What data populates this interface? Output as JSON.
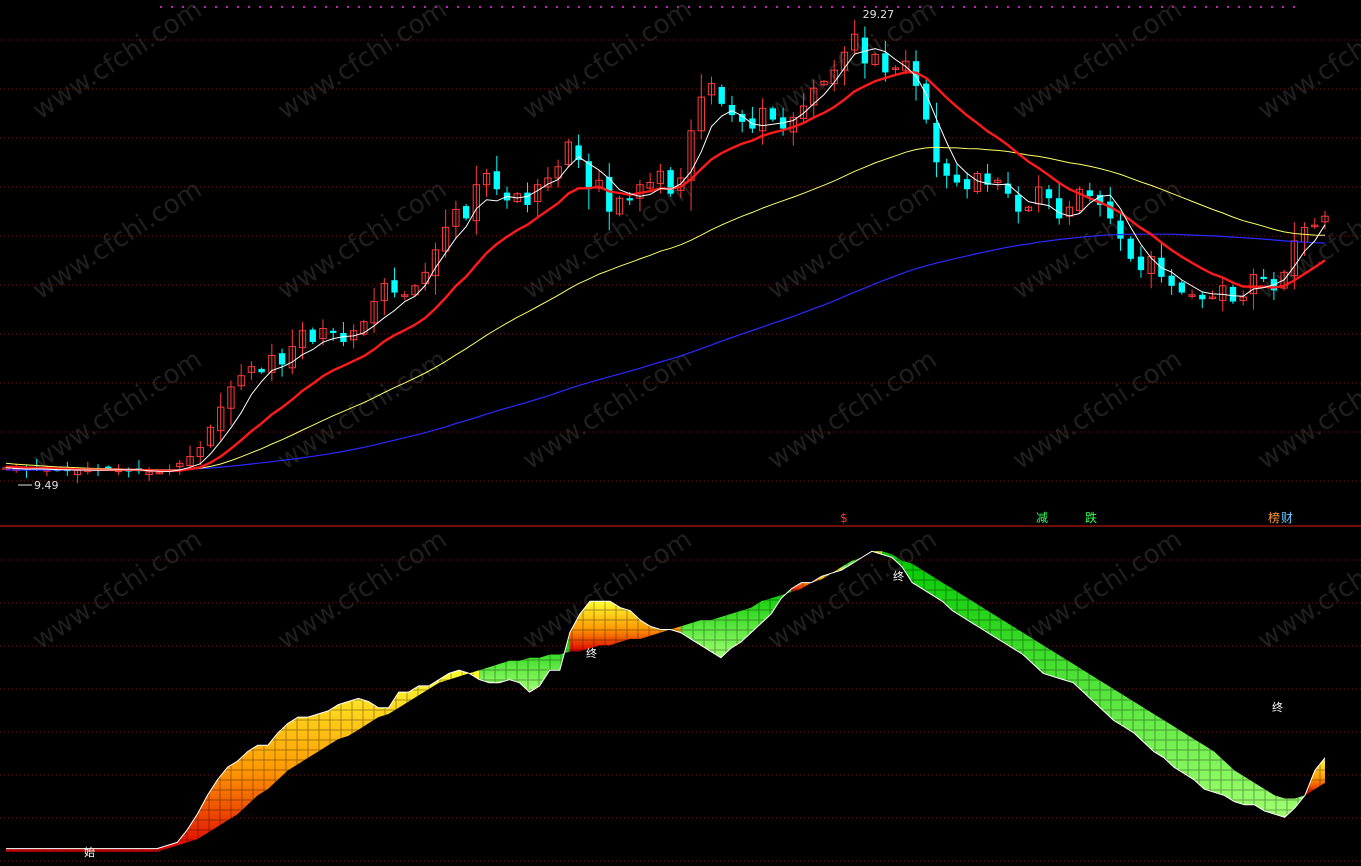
{
  "chart_data": [
    {
      "type": "candlestick",
      "title": "",
      "ylim": [
        8.8,
        29.9
      ],
      "grid": "dotted red horizontal",
      "annotations": {
        "high_label": "29.27",
        "low_label": "9.49"
      },
      "colors": {
        "up": "#ff3a3a",
        "down": "#00ffff",
        "ma_fast": "#ffffff",
        "ma_mid": "#ff1a1a",
        "ma_slow": "#ffff66",
        "ma_long": "#2a2aff"
      },
      "signals": [
        {
          "text": "$",
          "color": "#ff3030"
        },
        {
          "text": "减",
          "color": "#33ff55"
        },
        {
          "text": "跌",
          "color": "#33ff55"
        },
        {
          "text": "榜",
          "color": "#ff9933"
        },
        {
          "text": "财",
          "color": "#66ccff"
        }
      ],
      "closes": [
        9.7,
        9.65,
        9.6,
        9.68,
        9.62,
        9.58,
        9.55,
        9.58,
        9.62,
        9.6,
        9.66,
        9.6,
        9.58,
        9.55,
        9.52,
        9.5,
        9.6,
        9.9,
        10.2,
        10.6,
        11.5,
        12.4,
        13.3,
        13.8,
        14.2,
        13.95,
        14.7,
        14.3,
        15.1,
        15.8,
        15.3,
        15.9,
        15.7,
        15.3,
        15.8,
        16.2,
        17.1,
        17.9,
        17.5,
        17.4,
        17.8,
        18.4,
        19.4,
        20.4,
        21.2,
        20.8,
        22.3,
        22.8,
        22.1,
        21.6,
        21.9,
        21.4,
        22.3,
        22.6,
        23.1,
        24.2,
        23.4,
        22.1,
        22.5,
        21.1,
        21.7,
        21.6,
        22.3,
        22.4,
        22.9,
        21.9,
        22.6,
        24.7,
        26.2,
        26.8,
        25.9,
        25.4,
        25.1,
        24.8,
        25.7,
        25.2,
        24.8,
        25.3,
        25.8,
        26.6,
        26.9,
        27.4,
        28.2,
        29.0,
        27.7,
        28.1,
        27.3,
        27.5,
        27.8,
        26.7,
        25.2,
        23.3,
        22.7,
        22.4,
        22.1,
        22.8,
        22.3,
        22.5,
        21.9,
        21.1,
        21.3,
        22.2,
        21.7,
        20.8,
        21.3,
        22.1,
        21.8,
        21.4,
        20.8,
        19.9,
        19.0,
        18.5,
        19.1,
        18.2,
        17.8,
        17.5,
        17.4,
        17.2,
        17.3,
        17.8,
        17.1,
        17.3,
        18.3,
        18.1,
        17.6,
        18.4,
        19.8,
        20.4,
        20.5,
        20.9
      ],
      "ma_fast": [
        9.7,
        9.67,
        9.64,
        9.65,
        9.64,
        9.62,
        9.61,
        9.6,
        9.6,
        9.59,
        9.6,
        9.61,
        9.61,
        9.61,
        9.57,
        9.55,
        9.54,
        9.6,
        9.72,
        9.88,
        10.32,
        10.87,
        11.48,
        12.15,
        12.96,
        13.54,
        14.03,
        14.19,
        14.41,
        14.74,
        14.96,
        15.29,
        15.45,
        15.54,
        15.57,
        15.71,
        16.02,
        16.38,
        16.7,
        17.1,
        17.34,
        17.82,
        18.6,
        19.27,
        19.92,
        20.43,
        21.23,
        21.63,
        21.58,
        21.78,
        21.71,
        21.78,
        22.04,
        22.33,
        22.53,
        23.1,
        23.54,
        23.24,
        22.95,
        22.57,
        22.08,
        21.9,
        21.78,
        21.87,
        22.13,
        22.1,
        22.34,
        22.89,
        23.77,
        24.89,
        25.36,
        25.6,
        25.36,
        25.01,
        24.93,
        24.99,
        25.06,
        25.16,
        25.48,
        25.91,
        26.31,
        26.85,
        27.49,
        28.12,
        28.25,
        28.36,
        28.22,
        27.87,
        27.56,
        27.14,
        26.33,
        25.22,
        24.18,
        23.24,
        22.8,
        22.47,
        22.35,
        22.3,
        22.33,
        21.92,
        21.55,
        21.45,
        21.37,
        21.05,
        20.91,
        21.02,
        21.48,
        21.78,
        21.84,
        21.23,
        20.4,
        19.64,
        19.04,
        18.6,
        18.41,
        18.06,
        17.79,
        17.53,
        17.44,
        17.42,
        17.36,
        17.34,
        17.66,
        17.72,
        17.85,
        18.07,
        18.67,
        19.34,
        19.8,
        20.52
      ],
      "ma_mid": [
        9.75,
        9.73,
        9.71,
        9.7,
        9.68,
        9.66,
        9.65,
        9.63,
        9.62,
        9.61,
        9.61,
        9.61,
        9.61,
        9.61,
        9.59,
        9.57,
        9.57,
        9.58,
        9.64,
        9.72,
        9.93,
        10.2,
        10.55,
        10.93,
        11.33,
        11.68,
        12.07,
        12.39,
        12.74,
        13.13,
        13.44,
        13.78,
        14.04,
        14.24,
        14.46,
        14.67,
        14.97,
        15.33,
        15.6,
        15.83,
        16.07,
        16.37,
        16.79,
        17.27,
        17.8,
        18.21,
        18.74,
        19.26,
        19.66,
        19.98,
        20.28,
        20.52,
        20.85,
        21.16,
        21.48,
        21.91,
        22.14,
        22.14,
        22.22,
        22.0,
        21.93,
        21.85,
        21.93,
        22.01,
        22.14,
        22.12,
        22.21,
        22.55,
        23.0,
        23.43,
        23.71,
        23.93,
        24.13,
        24.27,
        24.48,
        24.62,
        24.73,
        24.87,
        25.05,
        25.29,
        25.5,
        25.76,
        26.09,
        26.46,
        26.69,
        26.91,
        27.05,
        27.19,
        27.31,
        27.29,
        27.05,
        26.62,
        26.17,
        25.77,
        25.38,
        25.04,
        24.68,
        24.39,
        24.06,
        23.68,
        23.33,
        23.04,
        22.72,
        22.38,
        22.1,
        21.9,
        21.7,
        21.51,
        21.31,
        21.05,
        20.71,
        20.37,
        20.09,
        19.73,
        19.39,
        19.09,
        18.82,
        18.56,
        18.33,
        18.17,
        17.94,
        17.77,
        17.76,
        17.76,
        17.72,
        17.8,
        18.04,
        18.34,
        18.63,
        18.94
      ],
      "ma_slow": [
        9.9,
        9.86,
        9.83,
        9.8,
        9.77,
        9.74,
        9.72,
        9.7,
        9.68,
        9.67,
        9.66,
        9.65,
        9.64,
        9.63,
        9.62,
        9.61,
        9.61,
        9.62,
        9.64,
        9.68,
        9.76,
        9.87,
        10.02,
        10.19,
        10.37,
        10.55,
        10.76,
        10.95,
        11.16,
        11.38,
        11.59,
        11.81,
        12.02,
        12.21,
        12.41,
        12.6,
        12.82,
        13.05,
        13.27,
        13.48,
        13.69,
        13.92,
        14.17,
        14.44,
        14.73,
        15.0,
        15.3,
        15.6,
        15.88,
        16.14,
        16.4,
        16.63,
        16.88,
        17.13,
        17.38,
        17.65,
        17.9,
        18.1,
        18.32,
        18.49,
        18.67,
        18.83,
        19.0,
        19.16,
        19.34,
        19.47,
        19.63,
        19.83,
        20.06,
        20.3,
        20.51,
        20.71,
        20.9,
        21.07,
        21.26,
        21.43,
        21.59,
        21.75,
        21.92,
        22.1,
        22.28,
        22.47,
        22.68,
        22.9,
        23.08,
        23.27,
        23.43,
        23.59,
        23.75,
        23.87,
        23.94,
        23.96,
        23.95,
        23.94,
        23.91,
        23.9,
        23.86,
        23.83,
        23.78,
        23.7,
        23.62,
        23.56,
        23.48,
        23.38,
        23.28,
        23.21,
        23.12,
        23.02,
        22.9,
        22.76,
        22.59,
        22.42,
        22.27,
        22.1,
        21.92,
        21.74,
        21.56,
        21.38,
        21.2,
        21.04,
        20.86,
        20.7,
        20.58,
        20.45,
        20.31,
        20.2,
        20.13,
        20.09,
        20.06,
        20.05
      ],
      "ma_long": [
        9.6,
        9.6,
        9.6,
        9.6,
        9.6,
        9.6,
        9.6,
        9.6,
        9.6,
        9.6,
        9.6,
        9.6,
        9.6,
        9.6,
        9.6,
        9.6,
        9.61,
        9.62,
        9.64,
        9.66,
        9.69,
        9.73,
        9.77,
        9.82,
        9.87,
        9.92,
        9.97,
        10.03,
        10.08,
        10.14,
        10.21,
        10.28,
        10.35,
        10.43,
        10.52,
        10.61,
        10.71,
        10.82,
        10.93,
        11.04,
        11.15,
        11.26,
        11.39,
        11.52,
        11.67,
        11.8,
        11.94,
        12.09,
        12.23,
        12.36,
        12.49,
        12.62,
        12.76,
        12.9,
        13.05,
        13.21,
        13.36,
        13.49,
        13.62,
        13.75,
        13.87,
        14.0,
        14.13,
        14.27,
        14.41,
        14.54,
        14.68,
        14.84,
        15.0,
        15.17,
        15.34,
        15.5,
        15.66,
        15.81,
        15.97,
        16.13,
        16.28,
        16.44,
        16.61,
        16.78,
        16.95,
        17.13,
        17.33,
        17.52,
        17.7,
        17.89,
        18.07,
        18.24,
        18.41,
        18.56,
        18.69,
        18.81,
        18.92,
        19.03,
        19.13,
        19.24,
        19.33,
        19.43,
        19.52,
        19.6,
        19.66,
        19.74,
        19.8,
        19.86,
        19.91,
        19.96,
        20.0,
        20.04,
        20.07,
        20.08,
        20.1,
        20.1,
        20.1,
        20.1,
        20.1,
        20.08,
        20.06,
        20.04,
        20.02,
        20.0,
        19.97,
        19.94,
        19.91,
        19.88,
        19.84,
        19.8,
        19.77,
        19.74,
        19.72,
        19.7
      ]
    },
    {
      "type": "area",
      "title": "",
      "ylim": [
        0,
        100
      ],
      "labels": {
        "start": "始",
        "end": "终"
      },
      "colors": {
        "rise_top": "#ffff33",
        "rise_bottom": "#dd0000",
        "fall_top": "#00dd00",
        "fall_bottom": "#99ff66"
      },
      "top": [
        3,
        3,
        3,
        3,
        3,
        3,
        3,
        3,
        3,
        3,
        3,
        3,
        3,
        3,
        3,
        3,
        4,
        5,
        9,
        14,
        20,
        25,
        29,
        31,
        34,
        36,
        36,
        40,
        43,
        45,
        45,
        46,
        47,
        49,
        50,
        51,
        50,
        48,
        48,
        53,
        53,
        55,
        55,
        57,
        59,
        60,
        59,
        57,
        56,
        56,
        57,
        56,
        53,
        55,
        60,
        60,
        72,
        78,
        82,
        82,
        82,
        80,
        79,
        76,
        74,
        73,
        73,
        72,
        70,
        68,
        66,
        64,
        67,
        69,
        72,
        75,
        78,
        83,
        86,
        88,
        88,
        90,
        91,
        92,
        94,
        96,
        98,
        97,
        96,
        93,
        88,
        86,
        84,
        82,
        79,
        77,
        75,
        73,
        71,
        69,
        67,
        65,
        62,
        59,
        58,
        57,
        56,
        53,
        50,
        47,
        44,
        42,
        40,
        37,
        34,
        32,
        29,
        27,
        25,
        22,
        21,
        20,
        18,
        17,
        17,
        15,
        14,
        13,
        16,
        20,
        28,
        32
      ],
      "bottom": [
        2,
        2,
        2,
        2,
        2,
        2,
        2,
        2,
        2,
        2,
        2,
        2,
        2,
        2,
        2,
        2,
        3,
        4,
        5,
        6,
        8,
        10,
        12,
        14,
        17,
        20,
        22,
        25,
        28,
        30,
        32,
        34,
        36,
        38,
        39,
        41,
        43,
        45,
        46,
        48,
        50,
        52,
        54,
        56,
        57,
        58,
        59,
        60,
        61,
        62,
        63,
        63,
        64,
        64,
        65,
        65,
        66,
        66,
        67,
        68,
        68,
        69,
        70,
        70,
        71,
        72,
        73,
        74,
        75,
        76,
        76,
        77,
        78,
        79,
        80,
        82,
        83,
        84,
        85,
        86,
        88,
        89,
        91,
        93,
        95,
        96,
        98,
        98,
        97,
        95,
        94,
        92,
        90,
        88,
        86,
        84,
        82,
        80,
        78,
        76,
        74,
        72,
        70,
        68,
        66,
        64,
        62,
        60,
        58,
        56,
        54,
        52,
        50,
        48,
        46,
        44,
        42,
        40,
        38,
        36,
        34,
        31,
        28,
        26,
        24,
        22,
        20,
        19,
        19,
        20,
        22,
        24
      ]
    }
  ]
}
